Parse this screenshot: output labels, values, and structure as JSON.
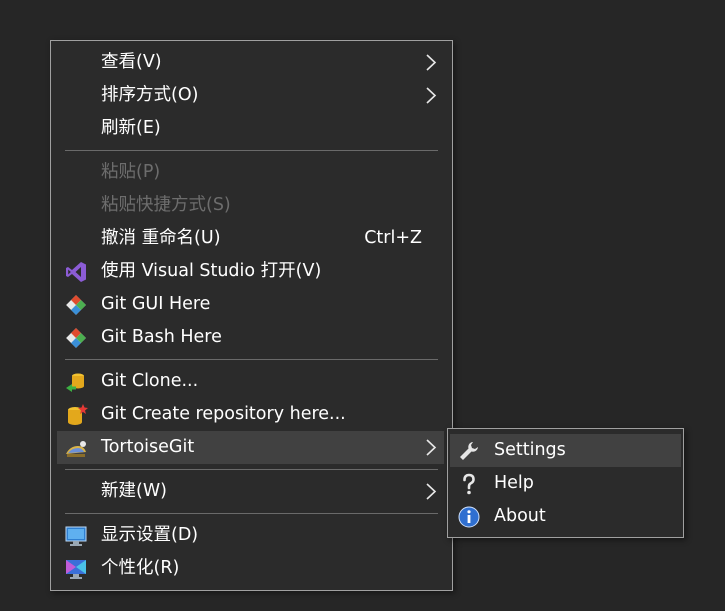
{
  "context_menu": {
    "items": [
      {
        "label": "查看(V)",
        "has_submenu": true
      },
      {
        "label": "排序方式(O)",
        "has_submenu": true
      },
      {
        "label": "刷新(E)"
      },
      {
        "label": "粘贴(P)",
        "disabled": true
      },
      {
        "label": "粘贴快捷方式(S)",
        "disabled": true
      },
      {
        "label": "撤消 重命名(U)",
        "shortcut": "Ctrl+Z"
      },
      {
        "label": "使用 Visual Studio 打开(V)",
        "icon": "visual-studio-icon"
      },
      {
        "label": "Git GUI Here",
        "icon": "git-icon"
      },
      {
        "label": "Git Bash Here",
        "icon": "git-icon"
      },
      {
        "label": "Git Clone...",
        "icon": "tortoisegit-clone-icon"
      },
      {
        "label": "Git Create repository here...",
        "icon": "tortoisegit-create-repo-icon"
      },
      {
        "label": "TortoiseGit",
        "icon": "tortoisegit-icon",
        "has_submenu": true,
        "highlighted": true
      },
      {
        "label": "新建(W)",
        "has_submenu": true
      },
      {
        "label": "显示设置(D)",
        "icon": "display-settings-icon"
      },
      {
        "label": "个性化(R)",
        "icon": "personalize-icon"
      }
    ]
  },
  "tortoisegit_submenu": {
    "items": [
      {
        "label": "Settings",
        "icon": "wrench-icon",
        "highlighted": true
      },
      {
        "label": "Help",
        "icon": "help-icon"
      },
      {
        "label": "About",
        "icon": "info-icon"
      }
    ]
  },
  "colors": {
    "background": "#262626",
    "menu_background": "#2b2b2b",
    "highlight": "#414141",
    "text": "#ffffff",
    "disabled_text": "#6d6d6d"
  }
}
